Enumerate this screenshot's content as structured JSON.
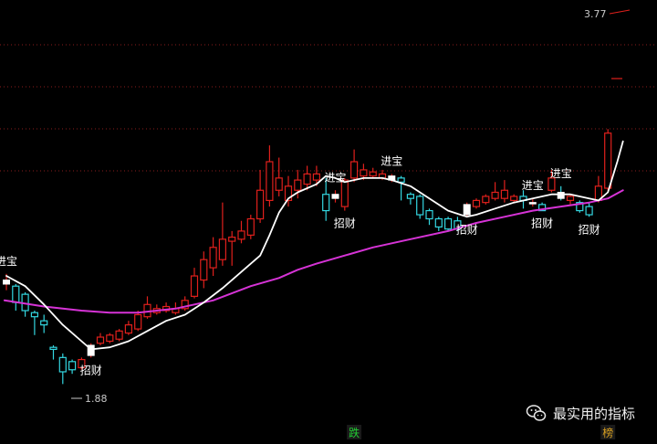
{
  "chart_data": {
    "type": "candlestick",
    "colors": {
      "background": "#000000",
      "up": "#e0201c",
      "down": "#33d6e0",
      "signal_body": "#ffffff",
      "ma_fast": "#ffffff",
      "ma_slow": "#d633d6",
      "grid": "#8a1c1c",
      "label": "#ffffff",
      "price_label": "#c8c8c8"
    },
    "y_range": [
      1.88,
      3.77
    ],
    "price_labels": [
      {
        "text": "3.77",
        "value": 3.77
      },
      {
        "text": "1.88",
        "value": 1.88
      }
    ],
    "candles": [
      {
        "o": 2.44,
        "c": 2.46,
        "h": 2.49,
        "l": 2.41,
        "kind": "signal"
      },
      {
        "o": 2.43,
        "c": 2.35,
        "h": 2.44,
        "l": 2.31,
        "kind": "down"
      },
      {
        "o": 2.39,
        "c": 2.31,
        "h": 2.4,
        "l": 2.28,
        "kind": "down"
      },
      {
        "o": 2.3,
        "c": 2.28,
        "h": 2.31,
        "l": 2.19,
        "kind": "down"
      },
      {
        "o": 2.26,
        "c": 2.24,
        "h": 2.29,
        "l": 2.2,
        "kind": "down"
      },
      {
        "o": 2.13,
        "c": 2.12,
        "h": 2.14,
        "l": 2.07,
        "kind": "down"
      },
      {
        "o": 2.08,
        "c": 2.01,
        "h": 2.1,
        "l": 1.95,
        "kind": "down"
      },
      {
        "o": 2.06,
        "c": 2.02,
        "h": 2.07,
        "l": 2.0,
        "kind": "down"
      },
      {
        "o": 2.03,
        "c": 2.07,
        "h": 2.08,
        "l": 2.02,
        "kind": "up"
      },
      {
        "o": 2.09,
        "c": 2.14,
        "h": 2.15,
        "l": 2.08,
        "kind": "signal"
      },
      {
        "o": 2.15,
        "c": 2.18,
        "h": 2.2,
        "l": 2.14,
        "kind": "up"
      },
      {
        "o": 2.16,
        "c": 2.19,
        "h": 2.2,
        "l": 2.15,
        "kind": "up"
      },
      {
        "o": 2.17,
        "c": 2.21,
        "h": 2.22,
        "l": 2.16,
        "kind": "up"
      },
      {
        "o": 2.2,
        "c": 2.24,
        "h": 2.26,
        "l": 2.19,
        "kind": "up"
      },
      {
        "o": 2.22,
        "c": 2.29,
        "h": 2.31,
        "l": 2.21,
        "kind": "up"
      },
      {
        "o": 2.28,
        "c": 2.34,
        "h": 2.38,
        "l": 2.27,
        "kind": "up"
      },
      {
        "o": 2.32,
        "c": 2.3,
        "h": 2.34,
        "l": 2.29,
        "kind": "up"
      },
      {
        "o": 2.31,
        "c": 2.33,
        "h": 2.35,
        "l": 2.3,
        "kind": "up"
      },
      {
        "o": 2.3,
        "c": 2.32,
        "h": 2.35,
        "l": 2.29,
        "kind": "up"
      },
      {
        "o": 2.32,
        "c": 2.36,
        "h": 2.38,
        "l": 2.31,
        "kind": "up"
      },
      {
        "o": 2.38,
        "c": 2.48,
        "h": 2.52,
        "l": 2.37,
        "kind": "up"
      },
      {
        "o": 2.46,
        "c": 2.56,
        "h": 2.6,
        "l": 2.42,
        "kind": "up"
      },
      {
        "o": 2.52,
        "c": 2.62,
        "h": 2.67,
        "l": 2.48,
        "kind": "up"
      },
      {
        "o": 2.56,
        "c": 2.66,
        "h": 2.84,
        "l": 2.53,
        "kind": "up"
      },
      {
        "o": 2.65,
        "c": 2.67,
        "h": 2.7,
        "l": 2.53,
        "kind": "up"
      },
      {
        "o": 2.66,
        "c": 2.7,
        "h": 2.75,
        "l": 2.64,
        "kind": "up"
      },
      {
        "o": 2.68,
        "c": 2.76,
        "h": 2.78,
        "l": 2.66,
        "kind": "up"
      },
      {
        "o": 2.76,
        "c": 2.9,
        "h": 3.0,
        "l": 2.74,
        "kind": "up"
      },
      {
        "o": 2.85,
        "c": 3.04,
        "h": 3.12,
        "l": 2.82,
        "kind": "up"
      },
      {
        "o": 2.9,
        "c": 2.96,
        "h": 3.06,
        "l": 2.87,
        "kind": "up"
      },
      {
        "o": 2.85,
        "c": 2.92,
        "h": 2.97,
        "l": 2.82,
        "kind": "up"
      },
      {
        "o": 2.9,
        "c": 2.95,
        "h": 3.0,
        "l": 2.86,
        "kind": "up"
      },
      {
        "o": 2.93,
        "c": 2.98,
        "h": 3.02,
        "l": 2.9,
        "kind": "up"
      },
      {
        "o": 2.95,
        "c": 2.98,
        "h": 3.02,
        "l": 2.92,
        "kind": "up"
      },
      {
        "o": 2.88,
        "c": 2.8,
        "h": 2.96,
        "l": 2.75,
        "kind": "down"
      },
      {
        "o": 2.86,
        "c": 2.88,
        "h": 2.9,
        "l": 2.84,
        "kind": "signal"
      },
      {
        "o": 2.82,
        "c": 2.95,
        "h": 2.96,
        "l": 2.8,
        "kind": "up"
      },
      {
        "o": 2.96,
        "c": 3.04,
        "h": 3.1,
        "l": 2.94,
        "kind": "up"
      },
      {
        "o": 2.97,
        "c": 3.0,
        "h": 3.03,
        "l": 2.95,
        "kind": "up"
      },
      {
        "o": 2.97,
        "c": 2.99,
        "h": 3.01,
        "l": 2.96,
        "kind": "up"
      },
      {
        "o": 2.96,
        "c": 2.98,
        "h": 3.0,
        "l": 2.95,
        "kind": "up"
      },
      {
        "o": 2.95,
        "c": 2.97,
        "h": 2.98,
        "l": 2.94,
        "kind": "signal"
      },
      {
        "o": 2.96,
        "c": 2.94,
        "h": 2.97,
        "l": 2.85,
        "kind": "down"
      },
      {
        "o": 2.88,
        "c": 2.86,
        "h": 2.89,
        "l": 2.83,
        "kind": "down"
      },
      {
        "o": 2.87,
        "c": 2.78,
        "h": 2.88,
        "l": 2.76,
        "kind": "down"
      },
      {
        "o": 2.8,
        "c": 2.76,
        "h": 2.81,
        "l": 2.73,
        "kind": "down"
      },
      {
        "o": 2.76,
        "c": 2.72,
        "h": 2.77,
        "l": 2.7,
        "kind": "down"
      },
      {
        "o": 2.76,
        "c": 2.71,
        "h": 2.77,
        "l": 2.7,
        "kind": "down"
      },
      {
        "o": 2.75,
        "c": 2.71,
        "h": 2.77,
        "l": 2.7,
        "kind": "down"
      },
      {
        "o": 2.78,
        "c": 2.83,
        "h": 2.84,
        "l": 2.77,
        "kind": "signal"
      },
      {
        "o": 2.82,
        "c": 2.85,
        "h": 2.86,
        "l": 2.81,
        "kind": "up"
      },
      {
        "o": 2.84,
        "c": 2.87,
        "h": 2.88,
        "l": 2.83,
        "kind": "up"
      },
      {
        "o": 2.86,
        "c": 2.89,
        "h": 2.94,
        "l": 2.85,
        "kind": "up"
      },
      {
        "o": 2.86,
        "c": 2.9,
        "h": 2.95,
        "l": 2.84,
        "kind": "up"
      },
      {
        "o": 2.87,
        "c": 2.85,
        "h": 2.88,
        "l": 2.84,
        "kind": "up"
      },
      {
        "o": 2.87,
        "c": 2.85,
        "h": 2.9,
        "l": 2.81,
        "kind": "down"
      },
      {
        "o": 2.84,
        "c": 2.84,
        "h": 2.86,
        "l": 2.82,
        "kind": "signal"
      },
      {
        "o": 2.83,
        "c": 2.8,
        "h": 2.84,
        "l": 2.8,
        "kind": "down"
      },
      {
        "o": 2.9,
        "c": 2.96,
        "h": 3.0,
        "l": 2.89,
        "kind": "up"
      },
      {
        "o": 2.89,
        "c": 2.86,
        "h": 2.92,
        "l": 2.85,
        "kind": "signal"
      },
      {
        "o": 2.85,
        "c": 2.87,
        "h": 2.88,
        "l": 2.83,
        "kind": "up"
      },
      {
        "o": 2.84,
        "c": 2.8,
        "h": 2.85,
        "l": 2.79,
        "kind": "down"
      },
      {
        "o": 2.82,
        "c": 2.78,
        "h": 2.84,
        "l": 2.77,
        "kind": "down"
      },
      {
        "o": 2.85,
        "c": 2.92,
        "h": 2.97,
        "l": 2.84,
        "kind": "up"
      },
      {
        "o": 2.91,
        "c": 3.18,
        "h": 3.2,
        "l": 2.89,
        "kind": "up"
      }
    ],
    "ma_fast": [
      [
        0,
        2.48
      ],
      [
        2,
        2.43
      ],
      [
        4,
        2.34
      ],
      [
        6,
        2.24
      ],
      [
        8,
        2.16
      ],
      [
        9,
        2.12
      ],
      [
        11,
        2.13
      ],
      [
        13,
        2.16
      ],
      [
        15,
        2.21
      ],
      [
        17,
        2.26
      ],
      [
        19,
        2.29
      ],
      [
        21,
        2.35
      ],
      [
        23,
        2.42
      ],
      [
        25,
        2.5
      ],
      [
        27,
        2.58
      ],
      [
        28,
        2.68
      ],
      [
        29,
        2.79
      ],
      [
        30,
        2.86
      ],
      [
        31,
        2.89
      ],
      [
        33,
        2.93
      ],
      [
        34,
        2.97
      ],
      [
        35,
        2.96
      ],
      [
        36,
        2.94
      ],
      [
        38,
        2.96
      ],
      [
        40,
        2.96
      ],
      [
        41,
        2.95
      ],
      [
        43,
        2.92
      ],
      [
        45,
        2.86
      ],
      [
        47,
        2.8
      ],
      [
        49,
        2.77
      ],
      [
        50,
        2.78
      ],
      [
        52,
        2.81
      ],
      [
        54,
        2.84
      ],
      [
        56,
        2.86
      ],
      [
        58,
        2.88
      ],
      [
        60,
        2.88
      ],
      [
        61,
        2.87
      ],
      [
        62,
        2.86
      ],
      [
        63,
        2.85
      ],
      [
        64,
        2.89
      ],
      [
        65,
        3.04
      ],
      [
        65.6,
        3.14
      ]
    ],
    "ma_slow": [
      [
        -0.2,
        2.36
      ],
      [
        4,
        2.33
      ],
      [
        8,
        2.31
      ],
      [
        11,
        2.3
      ],
      [
        14,
        2.3
      ],
      [
        18,
        2.32
      ],
      [
        22,
        2.36
      ],
      [
        26,
        2.43
      ],
      [
        29,
        2.47
      ],
      [
        31,
        2.51
      ],
      [
        33,
        2.54
      ],
      [
        36,
        2.58
      ],
      [
        39,
        2.62
      ],
      [
        43,
        2.66
      ],
      [
        47,
        2.7
      ],
      [
        50,
        2.74
      ],
      [
        53,
        2.77
      ],
      [
        56,
        2.8
      ],
      [
        59,
        2.82
      ],
      [
        62,
        2.84
      ],
      [
        64,
        2.86
      ],
      [
        65.6,
        2.9
      ]
    ],
    "annotations": [
      {
        "text": "进宝",
        "candle": 0,
        "anchor": "high",
        "style": "signal-buy"
      },
      {
        "text": "招财",
        "candle": 9,
        "anchor": "low",
        "style": "signal-sell"
      },
      {
        "text": "进宝",
        "candle": 35,
        "anchor": "high",
        "style": "signal-buy"
      },
      {
        "text": "招财",
        "candle": 36,
        "anchor": "low",
        "style": "signal-sell"
      },
      {
        "text": "进宝",
        "candle": 41,
        "anchor": "high",
        "style": "signal-buy"
      },
      {
        "text": "招财",
        "candle": 49,
        "anchor": "low",
        "style": "signal-sell"
      },
      {
        "text": "进宝",
        "candle": 56,
        "anchor": "high",
        "style": "signal-buy"
      },
      {
        "text": "招财",
        "candle": 57,
        "anchor": "low",
        "style": "signal-sell"
      },
      {
        "text": "进宝",
        "candle": 59,
        "anchor": "high",
        "style": "signal-buy"
      },
      {
        "text": "招财",
        "candle": 62,
        "anchor": "low",
        "style": "signal-sell"
      }
    ],
    "bottom_tags": [
      {
        "text": "跌",
        "candle": 37,
        "color": "#22cc33"
      },
      {
        "text": "榜",
        "candle": 64,
        "color": "#d8a020"
      }
    ],
    "grid": "dashed-horizontal"
  },
  "watermark": {
    "text": "最实用的指标",
    "icon": "wechat-icon"
  }
}
